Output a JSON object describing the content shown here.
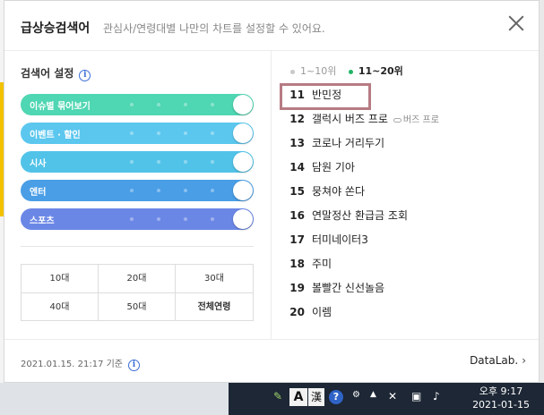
{
  "header": {
    "title": "급상승검색어",
    "subtitle": "관심사/연령대별 나만의 차트를 설정할 수 있어요."
  },
  "settings": {
    "title": "검색어 설정",
    "toggles": [
      {
        "label": "이슈별 묶어보기",
        "color": "#4fd6b2",
        "on": true
      },
      {
        "label": "이벤트 · 할인",
        "color": "#5cc7ee",
        "on": true
      },
      {
        "label": "시사",
        "color": "#52c3e8",
        "on": true
      },
      {
        "label": "엔터",
        "color": "#4a9ee6",
        "on": true
      },
      {
        "label": "스포츠",
        "color": "#6b87e6",
        "on": true
      }
    ],
    "ages": [
      "10대",
      "20대",
      "30대",
      "40대",
      "50대",
      "전체연령"
    ],
    "selected_age": "전체연령"
  },
  "tabs": {
    "first": "1~10위",
    "second": "11~20위",
    "active": "11~20위"
  },
  "ranks": [
    {
      "num": "11",
      "text": "반민정",
      "sub": ""
    },
    {
      "num": "12",
      "text": "갤럭시 버즈 프로",
      "sub": "버즈 프로"
    },
    {
      "num": "13",
      "text": "코로나 거리두기",
      "sub": ""
    },
    {
      "num": "14",
      "text": "담원 기아",
      "sub": ""
    },
    {
      "num": "15",
      "text": "뭉쳐야 쏜다",
      "sub": ""
    },
    {
      "num": "16",
      "text": "연말정산 환급금 조회",
      "sub": ""
    },
    {
      "num": "17",
      "text": "터미네이터3",
      "sub": ""
    },
    {
      "num": "18",
      "text": "주미",
      "sub": ""
    },
    {
      "num": "19",
      "text": "볼빨간 신선놀음",
      "sub": ""
    },
    {
      "num": "20",
      "text": "이렘",
      "sub": ""
    }
  ],
  "footer": {
    "updated": "2021.01.15. 21:17 기준",
    "brand": "DataLab."
  },
  "taskbar": {
    "ime_a": "A",
    "ime_han": "漢",
    "help": "?",
    "time": "오후 9:17",
    "date": "2021-01-15"
  },
  "colors": {
    "rank_active": "#20b566",
    "highlight_border": "#b77b83"
  }
}
